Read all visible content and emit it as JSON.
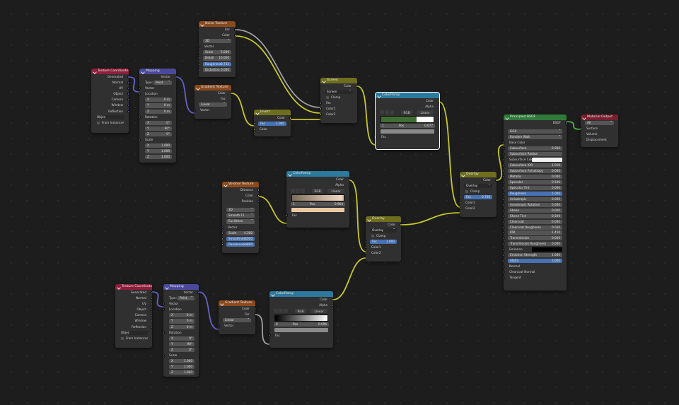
{
  "nodes": {
    "noise": {
      "title": "Noise Texture",
      "out": [
        "Fac",
        "Color"
      ],
      "dim": "3D",
      "in_label": "Vector",
      "fields": [
        {
          "label": "Scale",
          "value": "5.000"
        },
        {
          "label": "Detail",
          "value": "16.000"
        },
        {
          "label": "Roughness",
          "value": "0.733"
        },
        {
          "label": "Distortion",
          "value": "0.000"
        }
      ]
    },
    "texcoord1": {
      "title": "Texture Coordinate",
      "out": [
        "Generated",
        "Normal",
        "UV",
        "Object",
        "Camera",
        "Window",
        "Reflection"
      ],
      "object_label": "Object",
      "from_instancer": "From Instancer"
    },
    "mapping1": {
      "title": "Mapping",
      "out": "Vector",
      "type_label": "Type:",
      "type_value": "Point",
      "vector_label": "Vector",
      "location_label": "Location",
      "rotation_label": "Rotation",
      "scale_label": "Scale",
      "location": [
        {
          "axis": "X",
          "value": "0 m"
        },
        {
          "axis": "Y",
          "value": "0 m"
        },
        {
          "axis": "Z",
          "value": "0 m"
        }
      ],
      "rotation": [
        {
          "axis": "X",
          "value": "0°"
        },
        {
          "axis": "Y",
          "value": "90°"
        },
        {
          "axis": "Z",
          "value": "0°"
        }
      ],
      "scale": [
        {
          "axis": "X",
          "value": "1.000"
        },
        {
          "axis": "Y",
          "value": "1.000"
        },
        {
          "axis": "Z",
          "value": "1.000"
        }
      ]
    },
    "gradient1": {
      "title": "Gradient Texture",
      "out": [
        "Color",
        "Fac"
      ],
      "type_value": "Linear",
      "in_label": "Vector"
    },
    "invert": {
      "title": "Invert",
      "out": "Color",
      "fac_label": "Fac",
      "fac_value": "1.000",
      "in_label": "Color"
    },
    "screen": {
      "title": "Screen",
      "out": "Color",
      "mode": "Screen",
      "clamp": "Clamp",
      "in": [
        "Fac",
        "Color1",
        "Color2"
      ]
    },
    "ramp1": {
      "title": "ColorRamp",
      "out": [
        "Color",
        "Alpha"
      ],
      "mode": "RGB",
      "interp": "Linear",
      "index": "1",
      "pos_label": "Pos",
      "pos_value": "0.677",
      "in_label": "Fac"
    },
    "overlay1": {
      "title": "Overlay",
      "out": "Color",
      "mode": "Overlay",
      "clamp": "Clamp",
      "fac_label": "Fac",
      "fac_value": "0.700",
      "in": [
        "Color1",
        "Color2"
      ]
    },
    "voronoi": {
      "title": "Voronoi Texture",
      "out": [
        "Distance",
        "Color",
        "Position"
      ],
      "dim": "3D",
      "feature": "Smooth F1",
      "metric": "Euclidean",
      "in_label": "Vector",
      "fields": [
        {
          "label": "Scale",
          "value": "4.300"
        },
        {
          "label": "Smoothness",
          "value": "1.000"
        },
        {
          "label": "Randomness",
          "value": "1.000"
        }
      ]
    },
    "ramp2": {
      "title": "ColorRamp",
      "out": [
        "Color",
        "Alpha"
      ],
      "mode": "RGB",
      "interp": "Linear",
      "index": "1",
      "pos_label": "Pos",
      "pos_value": "0.964",
      "in_label": "Fac"
    },
    "overlay2": {
      "title": "Overlay",
      "out": "Color",
      "mode": "Overlay",
      "clamp": "Clamp",
      "fac_label": "Fac",
      "fac_value": "1.000",
      "in": [
        "Color1",
        "Color2"
      ]
    },
    "texcoord2": {
      "title": "Texture Coordinate",
      "out": [
        "Generated",
        "Normal",
        "UV",
        "Object",
        "Camera",
        "Window",
        "Reflection"
      ],
      "object_label": "Object",
      "from_instancer": "From Instancer"
    },
    "mapping2": {
      "title": "Mapping",
      "out": "Vector",
      "type_label": "Type:",
      "type_value": "Point",
      "vector_label": "Vector",
      "location_label": "Location",
      "rotation_label": "Rotation",
      "scale_label": "Scale",
      "location": [
        {
          "axis": "X",
          "value": "0 m"
        },
        {
          "axis": "Y",
          "value": "0 m"
        },
        {
          "axis": "Z",
          "value": "0 m"
        }
      ],
      "rotation": [
        {
          "axis": "X",
          "value": "0°"
        },
        {
          "axis": "Y",
          "value": "90°"
        },
        {
          "axis": "Z",
          "value": "0°"
        }
      ],
      "scale": [
        {
          "axis": "X",
          "value": "1.000"
        },
        {
          "axis": "Y",
          "value": "1.000"
        },
        {
          "axis": "Z",
          "value": "1.000"
        }
      ]
    },
    "gradient2": {
      "title": "Gradient Texture",
      "out": [
        "Color",
        "Fac"
      ],
      "type_value": "Linear",
      "in_label": "Vector"
    },
    "ramp3": {
      "title": "ColorRamp",
      "out": [
        "Color",
        "Alpha"
      ],
      "mode": "RGB",
      "interp": "Linear",
      "index": "0",
      "pos_label": "Pos",
      "pos_value": "0.096",
      "in_label": "Fac"
    },
    "bsdf": {
      "title": "Principled BSDF",
      "out": "BSDF",
      "dist": "GGX",
      "sss_method": "Random Walk",
      "base_color": "Base Color",
      "fields": [
        {
          "label": "Subsurface",
          "value": "0.000"
        },
        {
          "label": "Subsurface Radius",
          "value": ""
        },
        {
          "label": "Subsurface Color",
          "value": ""
        },
        {
          "label": "Subsurface IOR",
          "value": "1.010"
        },
        {
          "label": "Subsurface Anisotropy",
          "value": "0.000"
        },
        {
          "label": "Metallic",
          "value": "0.000"
        },
        {
          "label": "Specular",
          "value": "0.500"
        },
        {
          "label": "Specular Tint",
          "value": "0.000"
        },
        {
          "label": "Roughness",
          "value": "1.000"
        },
        {
          "label": "Anisotropic",
          "value": "0.000"
        },
        {
          "label": "Anisotropic Rotation",
          "value": "0.000"
        },
        {
          "label": "Sheen",
          "value": "0.000"
        },
        {
          "label": "Sheen Tint",
          "value": "0.500"
        },
        {
          "label": "Clearcoat",
          "value": "0.000"
        },
        {
          "label": "Clearcoat Roughness",
          "value": "0.030"
        },
        {
          "label": "IOR",
          "value": "1.450"
        },
        {
          "label": "Transmission",
          "value": "0.000"
        },
        {
          "label": "Transmission Roughness",
          "value": "0.000"
        },
        {
          "label": "Emission",
          "value": ""
        },
        {
          "label": "Emission Strength",
          "value": "1.000"
        },
        {
          "label": "Alpha",
          "value": "1.000"
        }
      ],
      "tail": [
        "Normal",
        "Clearcoat Normal",
        "Tangent"
      ]
    },
    "output": {
      "title": "Material Output",
      "target": "All",
      "in": [
        "Surface",
        "Volume",
        "Displacement"
      ]
    }
  },
  "colors": {
    "link_yellow": "#c7c729",
    "link_gray": "#a1a1a1",
    "link_purple": "#6363c7",
    "link_green": "#4fb04f",
    "selected_outline": "#ffffff"
  }
}
